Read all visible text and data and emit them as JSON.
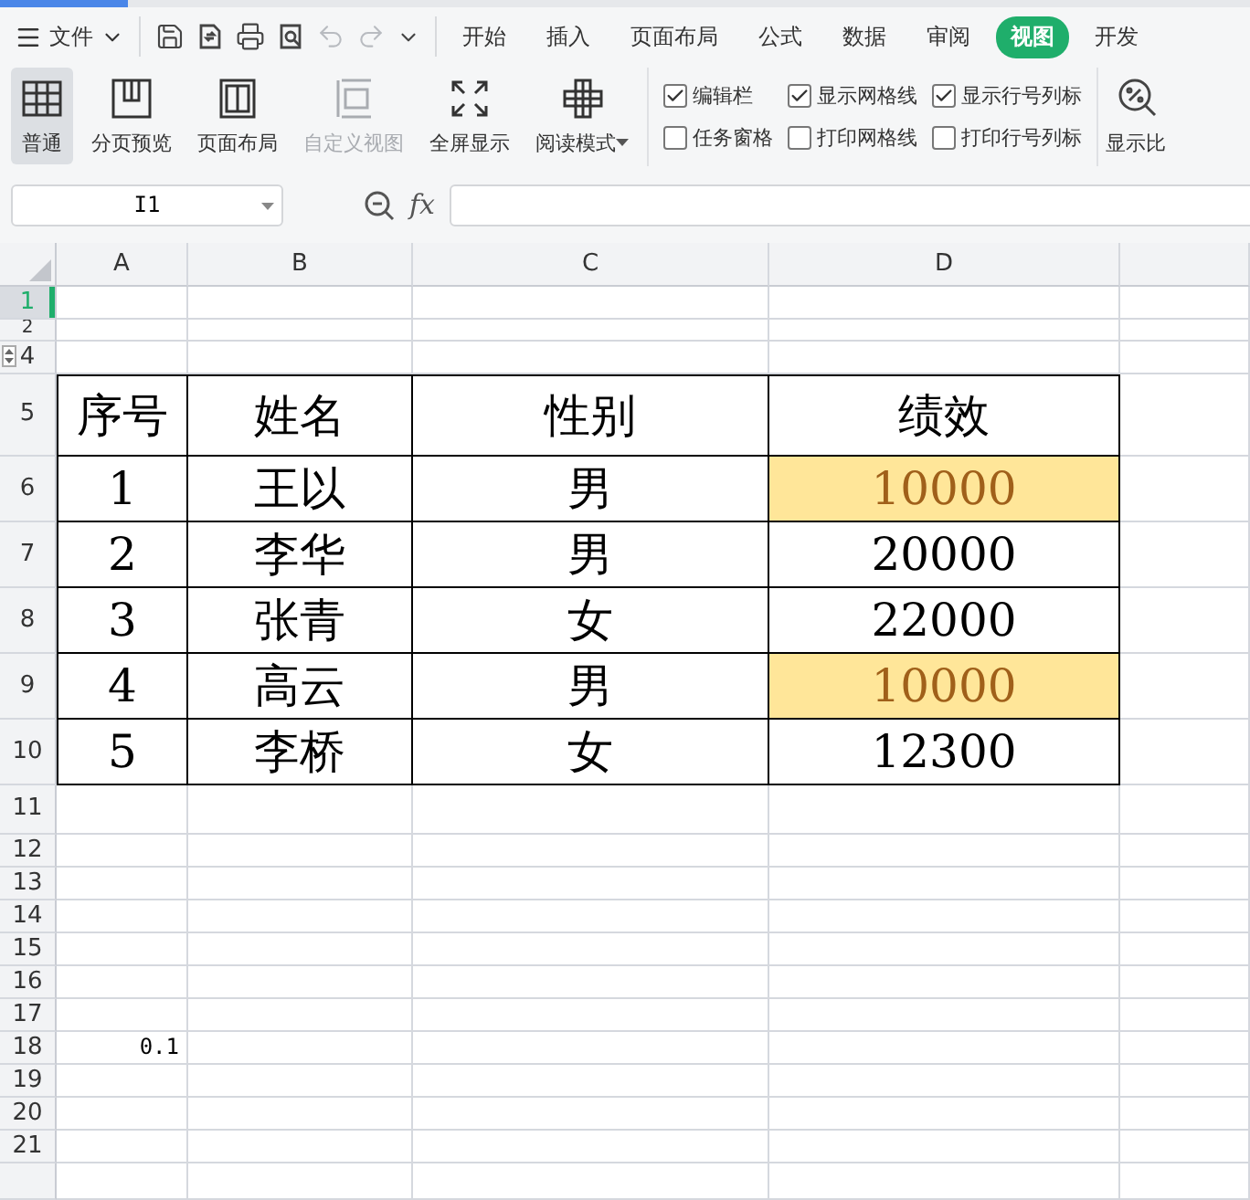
{
  "menu": {
    "label": "文件"
  },
  "quick_tools": [
    {
      "kind": "save",
      "disabled": false
    },
    {
      "kind": "export",
      "disabled": false
    },
    {
      "kind": "print",
      "disabled": false
    },
    {
      "kind": "preview",
      "disabled": false
    },
    {
      "kind": "undo",
      "disabled": true
    },
    {
      "kind": "redo",
      "disabled": true
    },
    {
      "kind": "more",
      "disabled": false
    }
  ],
  "tabs": [
    {
      "label": "开始",
      "selected": false
    },
    {
      "label": "插入",
      "selected": false
    },
    {
      "label": "页面布局",
      "selected": false
    },
    {
      "label": "公式",
      "selected": false
    },
    {
      "label": "数据",
      "selected": false
    },
    {
      "label": "审阅",
      "selected": false
    },
    {
      "label": "视图",
      "selected": true
    },
    {
      "label": "开发",
      "selected": false
    }
  ],
  "ribbon": {
    "views": [
      {
        "label": "普通",
        "kind": "grid",
        "selected": true,
        "disabled": false
      },
      {
        "label": "分页预览",
        "kind": "pagebreak",
        "selected": false,
        "disabled": false
      },
      {
        "label": "页面布局",
        "kind": "layout",
        "selected": false,
        "disabled": false
      },
      {
        "label": "自定义视图",
        "kind": "custom",
        "selected": false,
        "disabled": true
      },
      {
        "label": "全屏显示",
        "kind": "fullscreen",
        "selected": false,
        "disabled": false
      },
      {
        "label": "阅读模式",
        "kind": "reading",
        "selected": false,
        "disabled": false
      }
    ],
    "options": [
      {
        "label": "编辑栏",
        "checked": true
      },
      {
        "label": "显示网格线",
        "checked": true
      },
      {
        "label": "显示行号列标",
        "checked": true
      },
      {
        "label": "任务窗格",
        "checked": false
      },
      {
        "label": "打印网格线",
        "checked": false
      },
      {
        "label": "打印行号列标",
        "checked": false
      }
    ],
    "zoom": {
      "label": "显示比"
    }
  },
  "formula_bar": {
    "name_box": "I1",
    "fx_label": "fx"
  },
  "sheet": {
    "columns": [
      "A",
      "B",
      "C",
      "D"
    ],
    "rows": [
      {
        "label": "1",
        "kind": "plain",
        "selected": true,
        "cells": []
      },
      {
        "label": "2",
        "kind": "thin",
        "selected": false,
        "cells": []
      },
      {
        "label": "4",
        "kind": "plain",
        "selected": false,
        "cells": []
      },
      {
        "label": "5",
        "kind": "table-head",
        "selected": false,
        "cells": [
          {
            "text": "序号",
            "highlighted": false
          },
          {
            "text": "姓名",
            "highlighted": false
          },
          {
            "text": "性别",
            "highlighted": false
          },
          {
            "text": "绩效",
            "highlighted": false
          }
        ]
      },
      {
        "label": "6",
        "kind": "table-body",
        "selected": false,
        "cells": [
          {
            "text": "1",
            "highlighted": false
          },
          {
            "text": "王以",
            "highlighted": false
          },
          {
            "text": "男",
            "highlighted": false
          },
          {
            "text": "10000",
            "highlighted": true
          }
        ]
      },
      {
        "label": "7",
        "kind": "table-body",
        "selected": false,
        "cells": [
          {
            "text": "2",
            "highlighted": false
          },
          {
            "text": "李华",
            "highlighted": false
          },
          {
            "text": "男",
            "highlighted": false
          },
          {
            "text": "20000",
            "highlighted": false
          }
        ]
      },
      {
        "label": "8",
        "kind": "table-body",
        "selected": false,
        "cells": [
          {
            "text": "3",
            "highlighted": false
          },
          {
            "text": "张青",
            "highlighted": false
          },
          {
            "text": "女",
            "highlighted": false
          },
          {
            "text": "22000",
            "highlighted": false
          }
        ]
      },
      {
        "label": "9",
        "kind": "table-body",
        "selected": false,
        "cells": [
          {
            "text": "4",
            "highlighted": false
          },
          {
            "text": "高云",
            "highlighted": false
          },
          {
            "text": "男",
            "highlighted": false
          },
          {
            "text": "10000",
            "highlighted": true
          }
        ]
      },
      {
        "label": "10",
        "kind": "table-body",
        "selected": false,
        "cells": [
          {
            "text": "5",
            "highlighted": false
          },
          {
            "text": "李桥",
            "highlighted": false
          },
          {
            "text": "女",
            "highlighted": false
          },
          {
            "text": "12300",
            "highlighted": false
          }
        ]
      },
      {
        "label": "11",
        "kind": "gap",
        "selected": false,
        "cells": []
      },
      {
        "label": "12",
        "kind": "compact",
        "selected": false,
        "cells": []
      },
      {
        "label": "13",
        "kind": "compact",
        "selected": false,
        "cells": []
      },
      {
        "label": "14",
        "kind": "compact",
        "selected": false,
        "cells": []
      },
      {
        "label": "15",
        "kind": "compact",
        "selected": false,
        "cells": []
      },
      {
        "label": "16",
        "kind": "compact",
        "selected": false,
        "cells": []
      },
      {
        "label": "17",
        "kind": "compact",
        "selected": false,
        "cells": []
      },
      {
        "label": "18",
        "kind": "compact",
        "selected": false,
        "cells": [
          {
            "text": "0.1",
            "highlighted": false
          }
        ]
      },
      {
        "label": "19",
        "kind": "compact",
        "selected": false,
        "cells": []
      },
      {
        "label": "20",
        "kind": "compact",
        "selected": false,
        "cells": []
      },
      {
        "label": "21",
        "kind": "compact",
        "selected": false,
        "cells": []
      }
    ]
  }
}
